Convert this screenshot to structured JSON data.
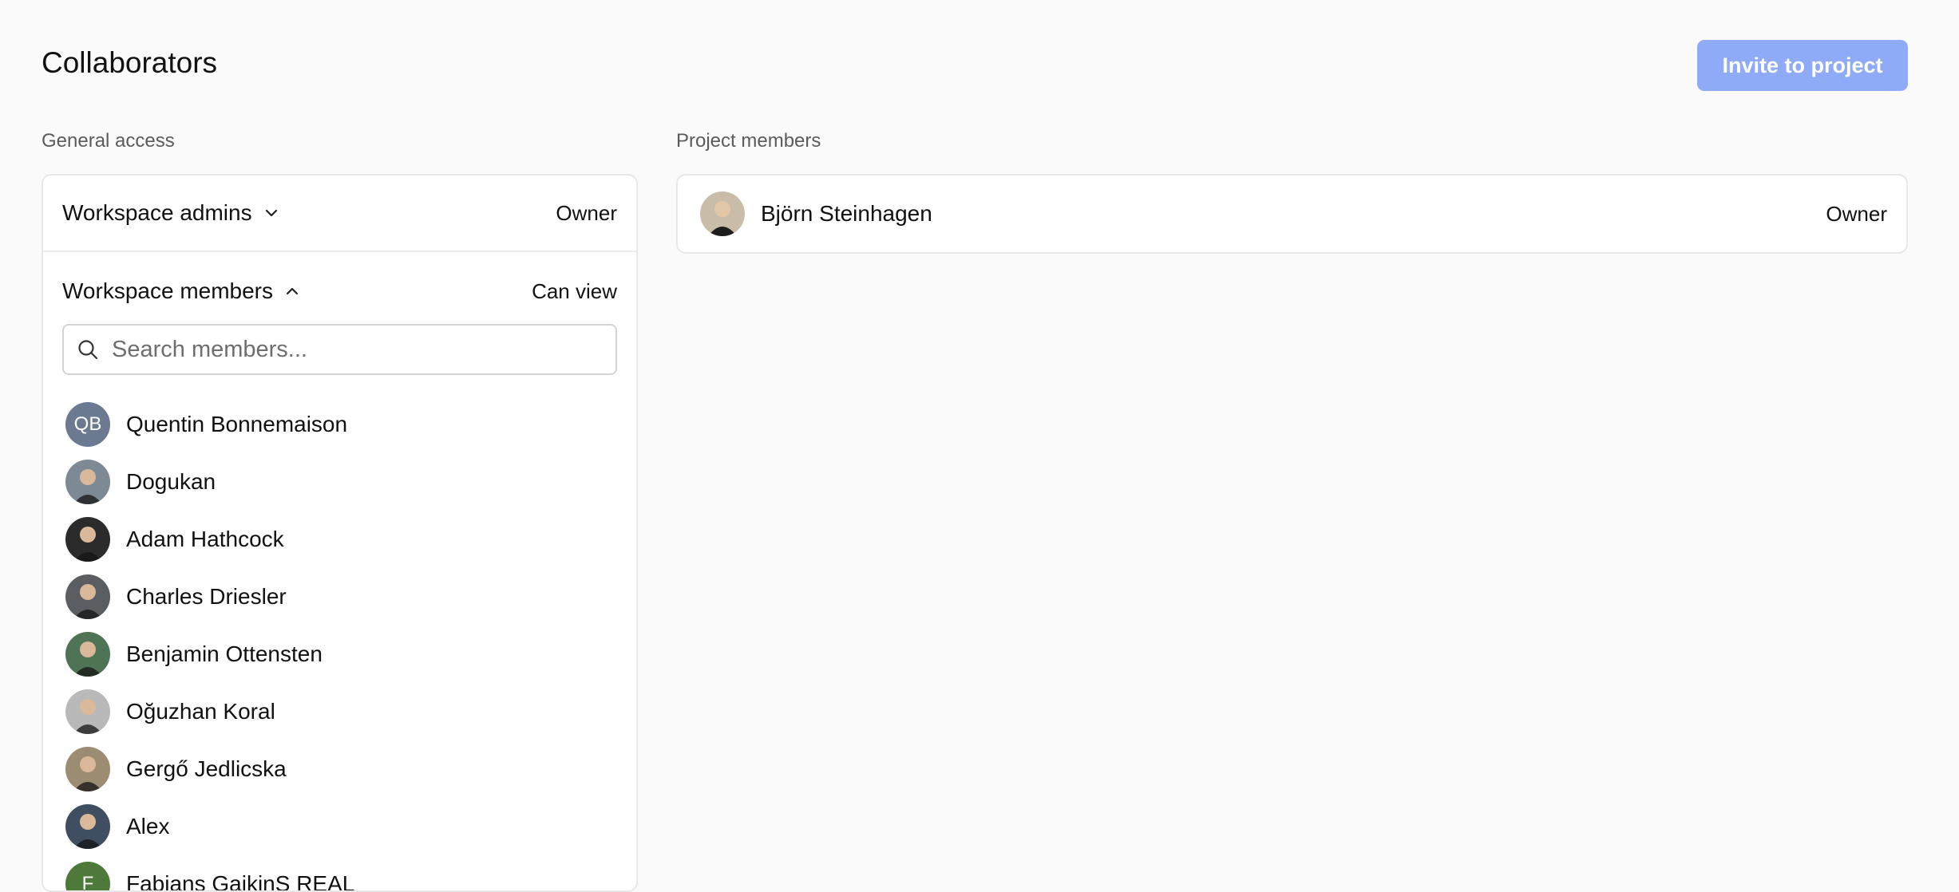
{
  "header": {
    "title": "Collaborators",
    "invite_label": "Invite to project"
  },
  "general_access": {
    "label": "General access",
    "admins": {
      "label": "Workspace admins",
      "role": "Owner",
      "expanded": false
    },
    "members": {
      "label": "Workspace members",
      "role": "Can view",
      "expanded": true
    },
    "search": {
      "placeholder": "Search members...",
      "value": ""
    },
    "member_list": [
      {
        "name": "Quentin Bonnemaison",
        "initials": "QB",
        "avatar_color": "#6b7a90"
      },
      {
        "name": "Dogukan",
        "initials": "",
        "avatar_color": "#7d8a96"
      },
      {
        "name": "Adam Hathcock",
        "initials": "",
        "avatar_color": "#2b2b2b"
      },
      {
        "name": "Charles Driesler",
        "initials": "",
        "avatar_color": "#5a5e63"
      },
      {
        "name": "Benjamin Ottensten",
        "initials": "",
        "avatar_color": "#4f7355"
      },
      {
        "name": "Oğuzhan Koral",
        "initials": "",
        "avatar_color": "#b9b9b9"
      },
      {
        "name": "Gergő Jedlicska",
        "initials": "",
        "avatar_color": "#9c8c72"
      },
      {
        "name": "Alex",
        "initials": "",
        "avatar_color": "#3f4e60"
      },
      {
        "name": "Fabians GaikinS REAL",
        "initials": "F",
        "avatar_color": "#4d7a3a"
      }
    ]
  },
  "project_members": {
    "label": "Project members",
    "members": [
      {
        "name": "Björn Steinhagen",
        "role": "Owner",
        "avatar_color": "#8a7a66"
      }
    ]
  },
  "colors": {
    "accent_button": "#8fabf7",
    "background": "#fafafa",
    "card_border": "#e8e8e8"
  }
}
